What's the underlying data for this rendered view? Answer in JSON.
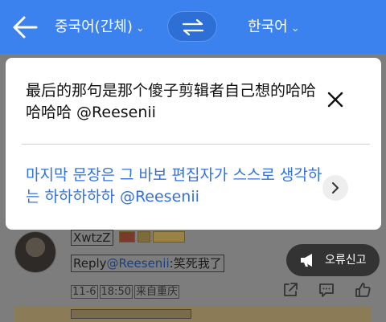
{
  "topbar": {
    "source_language": "중국어(간체)",
    "target_language": "한국어",
    "chevron": "⌄"
  },
  "popup": {
    "source_text": "最后的那句是那个傻子剪辑者自己想的哈哈哈哈哈 @Reesenii",
    "translated_text": "마지막 문장은 그 바보 편집자가 스스로 생각하는 하하하하하 @Reesenii"
  },
  "comment": {
    "username": "XwtzZ",
    "reply_prefix": "Reply",
    "mention": "@Reesenii",
    "reply_body": ":笑死我了",
    "date": "11-6",
    "time": "18:50",
    "location": "来自重庆"
  },
  "report_button": {
    "label": "오류신고"
  },
  "icons": {
    "back": "arrow-left-icon",
    "swap": "swap-arrows-icon",
    "close": "close-icon",
    "more": "chevron-right-icon",
    "report": "megaphone-icon",
    "share": "share-icon",
    "reply": "comment-icon",
    "like": "thumbs-up-icon"
  },
  "colors": {
    "topbar": "#3b82ee",
    "translation_text": "#2f72e0",
    "report_bg": "#333333"
  }
}
